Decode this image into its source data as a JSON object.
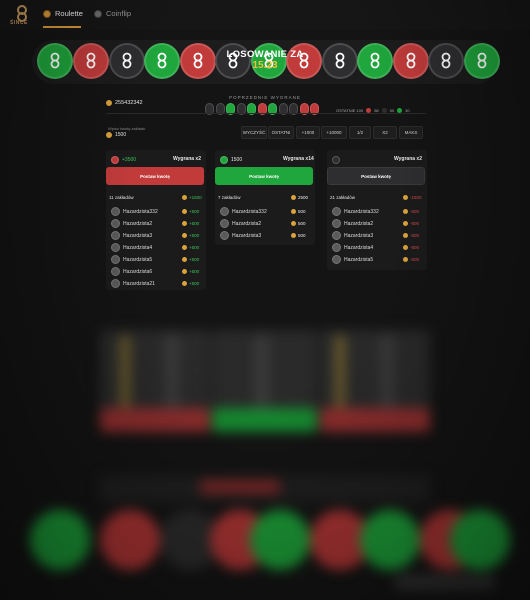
{
  "nav": {
    "logo_text": "ŚINCE",
    "tabs": [
      {
        "label": "Roulette",
        "icon": "roulette-coin-icon",
        "active": true
      },
      {
        "label": "Coinflip",
        "icon": "coinflip-coin-icon",
        "active": false
      }
    ]
  },
  "wheel": {
    "countdown_title": "LOSOWANIE ZA",
    "countdown_value": "15.23",
    "coins": [
      "green",
      "red",
      "black",
      "green",
      "red",
      "black",
      "green",
      "red",
      "black",
      "green",
      "red",
      "black",
      "green"
    ]
  },
  "previous": {
    "label": "POPRZEDNIE WYGRANE",
    "results": [
      "black",
      "black",
      "green",
      "black",
      "green",
      "red",
      "green",
      "black",
      "black",
      "red",
      "red"
    ],
    "last100_label": "OSTATNIE 100",
    "last100": [
      {
        "color": "#c23b3b",
        "count": "58"
      },
      {
        "color": "#2e2e31",
        "count": "50"
      },
      {
        "color": "#1fa63c",
        "count": "30"
      }
    ]
  },
  "balance": {
    "value": "255432342"
  },
  "bet": {
    "label": "Wpisz kwotę zakładu",
    "value": "1500",
    "quick_buttons": [
      "WYCZYŚĆ",
      "OSTATNI",
      "+1000",
      "+10000",
      "1/2",
      "X2",
      "MAKS"
    ]
  },
  "columns": [
    {
      "color": "red",
      "head_value": "+3500",
      "multiplier": "Wygrana x2",
      "button": "Postaw kwotę",
      "bets_count": "11 zakładów",
      "bets_total": "+1500",
      "rows": [
        {
          "name": "Hazardzista332",
          "amount": "+500",
          "kind": "pos"
        },
        {
          "name": "Hazardzista2",
          "amount": "+500",
          "kind": "pos"
        },
        {
          "name": "Hazardzista3",
          "amount": "+500",
          "kind": "pos"
        },
        {
          "name": "Hazardzista4",
          "amount": "+500",
          "kind": "pos"
        },
        {
          "name": "Hazardzista5",
          "amount": "+500",
          "kind": "pos"
        },
        {
          "name": "Hazardzista6",
          "amount": "+500",
          "kind": "pos"
        },
        {
          "name": "Hazardzista21",
          "amount": "+500",
          "kind": "pos"
        }
      ]
    },
    {
      "color": "green",
      "head_value": "1500",
      "multiplier": "Wygrana x14",
      "button": "Postaw kwotę",
      "bets_count": "7 zakładów",
      "bets_total": "2500",
      "rows": [
        {
          "name": "Hazardzista332",
          "amount": "500",
          "kind": "neu"
        },
        {
          "name": "Hazardzista2",
          "amount": "500",
          "kind": "neu"
        },
        {
          "name": "Hazardzista3",
          "amount": "500",
          "kind": "neu"
        }
      ]
    },
    {
      "color": "black",
      "head_value": "",
      "multiplier": "Wygrana x2",
      "button": "Postaw kwotę",
      "bets_count": "21 zakładów",
      "bets_total": "-1500",
      "rows": [
        {
          "name": "Hazardzista332",
          "amount": "-500",
          "kind": "neg"
        },
        {
          "name": "Hazardzista2",
          "amount": "-500",
          "kind": "neg"
        },
        {
          "name": "Hazardzista3",
          "amount": "-500",
          "kind": "neg"
        },
        {
          "name": "Hazardzista4",
          "amount": "-500",
          "kind": "neg"
        },
        {
          "name": "Hazardzista5",
          "amount": "-500",
          "kind": "neg"
        }
      ]
    }
  ]
}
